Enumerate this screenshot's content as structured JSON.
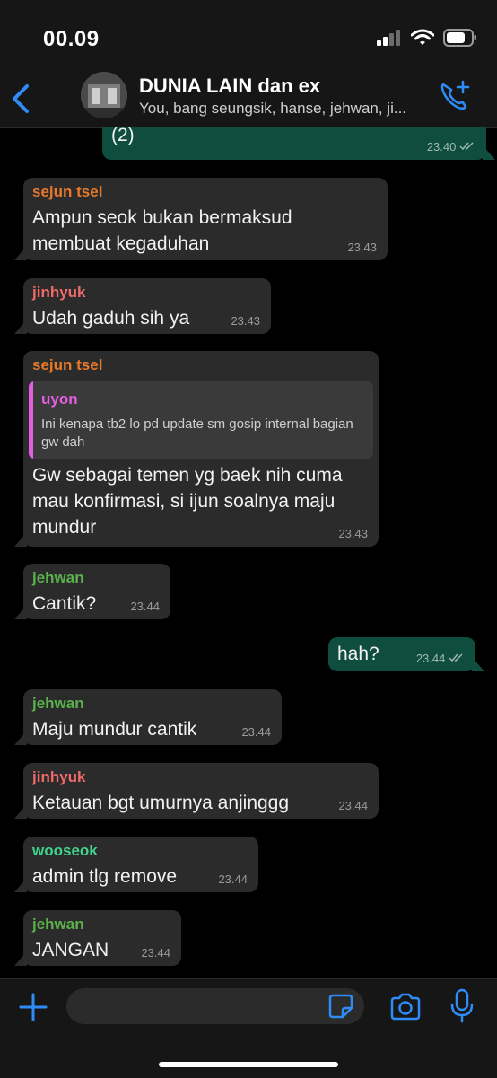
{
  "status_bar": {
    "time": "00.09"
  },
  "header": {
    "title": "DUNIA LAIN dan ex",
    "subtitle": "You, bang seungsik, hanse, jehwan, ji..."
  },
  "messages": [
    {
      "sender": "",
      "text": "(2)",
      "time": "23.40",
      "outgoing": true
    },
    {
      "sender": "sejun tsel",
      "sender_color": "#e8792b",
      "text": "Ampun seok bukan bermaksud membuat kegaduhan",
      "time": "23.43"
    },
    {
      "sender": "jinhyuk",
      "sender_color": "#ef6a6a",
      "text": "Udah gaduh sih ya",
      "time": "23.43"
    },
    {
      "sender": "sejun tsel",
      "sender_color": "#e8792b",
      "quote": {
        "name": "uyon",
        "name_color": "#e35ee0",
        "text": "Ini kenapa tb2 lo pd update sm gosip internal bagian gw dah"
      },
      "text": "Gw sebagai temen yg baek nih cuma mau konfirmasi, si ijun soalnya maju mundur",
      "time": "23.43"
    },
    {
      "sender": "jehwan",
      "sender_color": "#5bb14b",
      "text": "Cantik?",
      "time": "23.44"
    },
    {
      "sender": "",
      "text": "hah?",
      "time": "23.44",
      "outgoing": true
    },
    {
      "sender": "jehwan",
      "sender_color": "#5bb14b",
      "text": "Maju mundur cantik",
      "time": "23.44"
    },
    {
      "sender": "jinhyuk",
      "sender_color": "#ef6a6a",
      "text": "Ketauan bgt umurnya anjinggg",
      "time": "23.44"
    },
    {
      "sender": "wooseok",
      "sender_color": "#3fd38b",
      "text": "admin tlg remove",
      "time": "23.44"
    },
    {
      "sender": "jehwan",
      "sender_color": "#5bb14b",
      "text": "JANGAN",
      "time": "23.44"
    }
  ],
  "colors": {
    "accent": "#2f8cf7",
    "outgoing_bubble": "#0f4d3f",
    "incoming_bubble": "#2b2b2b"
  }
}
